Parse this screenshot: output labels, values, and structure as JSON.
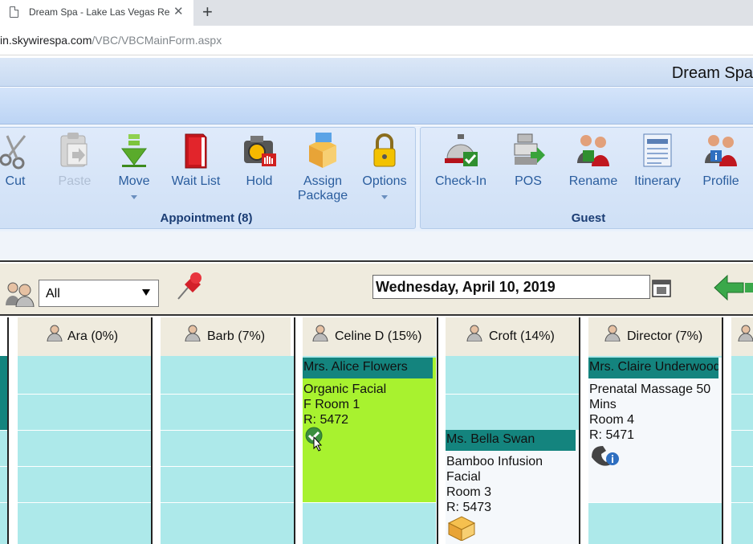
{
  "browser": {
    "tab_title": "Dream Spa - Lake Las Vegas Resort",
    "close_glyph": "✕",
    "newtab_glyph": "+",
    "url_prefix": "in.skywirespa.com",
    "url_path": "/VBC/VBCMainForm.aspx"
  },
  "app": {
    "title": "Dream Spa"
  },
  "ribbon": {
    "appointment_group": {
      "label": "Appointment (8)",
      "buttons": [
        {
          "label": "Cut",
          "icon": "scissors-icon"
        },
        {
          "label": "Paste",
          "icon": "paste-icon",
          "disabled": true
        },
        {
          "label": "Move",
          "icon": "move-arrow-icon",
          "dropdown": true
        },
        {
          "label": "Wait List",
          "icon": "book-icon"
        },
        {
          "label": "Hold",
          "icon": "camera-hold-icon"
        },
        {
          "label": "Assign",
          "label2": "Package",
          "icon": "package-icon"
        },
        {
          "label": "Options",
          "icon": "lock-icon",
          "dropdown": true
        }
      ]
    },
    "guest_group": {
      "label": "Guest",
      "buttons": [
        {
          "label": "Check-In",
          "icon": "bell-check-icon"
        },
        {
          "label": "POS",
          "icon": "register-icon"
        },
        {
          "label": "Rename",
          "icon": "rename-people-icon"
        },
        {
          "label": "Itinerary",
          "icon": "itinerary-icon"
        },
        {
          "label": "Profile",
          "icon": "profile-people-icon"
        }
      ]
    }
  },
  "toolbar": {
    "filter_value": "All",
    "date": "Wednesday, April 10, 2019"
  },
  "columns": [
    {
      "name": "Ara (0%)"
    },
    {
      "name": "Barb (7%)"
    },
    {
      "name": "Celine D (15%)"
    },
    {
      "name": "Croft (14%)"
    },
    {
      "name": "Director (7%)"
    }
  ],
  "appointments": [
    {
      "guest": "Mrs. Alice Flowers",
      "service": "Organic Facial",
      "room": "F Room 1",
      "ref": "R: 5472",
      "status_icon": "check-circle-icon"
    },
    {
      "guest": "Ms. Bella Swan",
      "service": "Bamboo Infusion",
      "service2": "Facial",
      "room": "Room 3",
      "ref": "R: 5473",
      "status_icon": "package-icon"
    },
    {
      "guest": "Mrs. Claire Underwood",
      "service": "Prenatal Massage 50",
      "service2": "Mins",
      "room": "Room 4",
      "ref": "R: 5471",
      "status_icon": "phone-info-icon"
    }
  ],
  "colors": {
    "slot": "#ade9ea",
    "guest_header": "#14847e",
    "checked_in": "#a8f22f",
    "header_bg": "#efebde"
  }
}
